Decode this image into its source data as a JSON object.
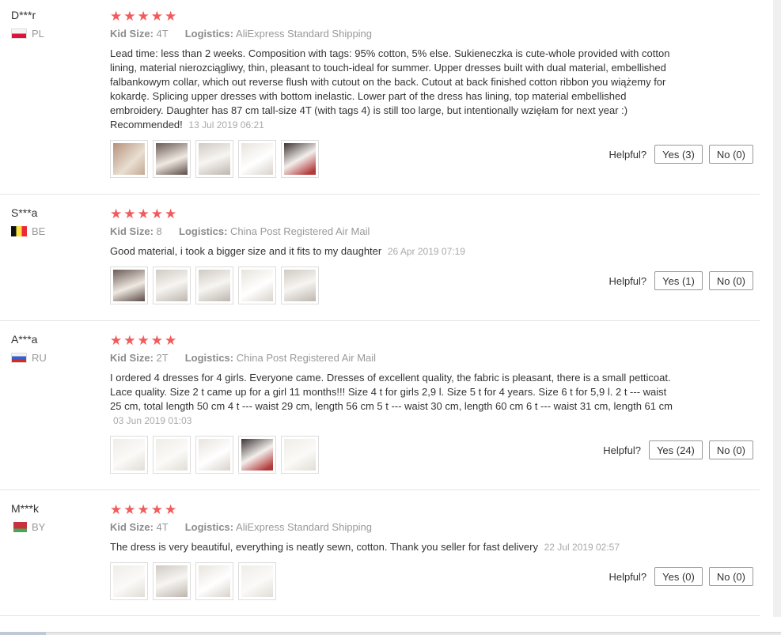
{
  "labels": {
    "kid_size": "Kid Size:",
    "logistics": "Logistics:",
    "helpful": "Helpful?"
  },
  "reviews": [
    {
      "user": "D***r",
      "country": "PL",
      "flag": "flag-pl",
      "stars": "★★★★★",
      "kid_size": "4T",
      "logistics": "AliExpress Standard Shipping",
      "text": "Lead time: less than 2 weeks. Composition with tags: 95% cotton, 5% else. Sukieneczka is cute-whole provided with cotton lining, material nierozciągliwy, thin, pleasant to touch-ideal for summer. Upper dresses built with dual material, embellished falbankowym collar, which out reverse flush with cutout on the back. Cutout at back finished cotton ribbon you wiążemy for kokardę. Splicing upper dresses with bottom inelastic. Lower part of the dress has lining, top material embellished embroidery. Daughter has 87 cm tall-size 4T (with tags 4) is still too large, but intentionally wzięłam for next year :) Recommended!",
      "date": "13 Jul 2019 06:21",
      "yes": "Yes (3)",
      "no": "No (0)"
    },
    {
      "user": "S***a",
      "country": "BE",
      "flag": "flag-be",
      "stars": "★★★★★",
      "kid_size": "8",
      "logistics": "China Post Registered Air Mail",
      "text": "Good material, i took a bigger size and it fits to my daughter",
      "date": "26 Apr 2019 07:19",
      "yes": "Yes (1)",
      "no": "No (0)"
    },
    {
      "user": "A***a",
      "country": "RU",
      "flag": "flag-ru",
      "stars": "★★★★★",
      "kid_size": "2T",
      "logistics": "China Post Registered Air Mail",
      "text": "I ordered 4 dresses for 4 girls. Everyone came. Dresses of excellent quality, the fabric is pleasant, there is a small petticoat. Lace quality. Size 2 t came up for a girl 11 months!!! Size 4 t for girls 2,9 l. Size 5 t for 4 years. Size 6 t for 5,9 l. 2 t --- waist 25 cm, total length 50 cm 4 t --- waist 29 cm, length 56 cm 5 t --- waist 30 cm, length 60 cm 6 t --- waist 31 cm, length 61 cm",
      "date": "03 Jun 2019 01:03",
      "yes": "Yes (24)",
      "no": "No (0)"
    },
    {
      "user": "M***k",
      "country": "BY",
      "flag": "flag-by",
      "stars": "★★★★★",
      "kid_size": "4T",
      "logistics": "AliExpress Standard Shipping",
      "text": "The dress is very beautiful, everything is neatly sewn, cotton. Thank you seller for fast delivery",
      "date": "22 Jul 2019 02:57",
      "yes": "Yes (0)",
      "no": "No (0)"
    }
  ]
}
